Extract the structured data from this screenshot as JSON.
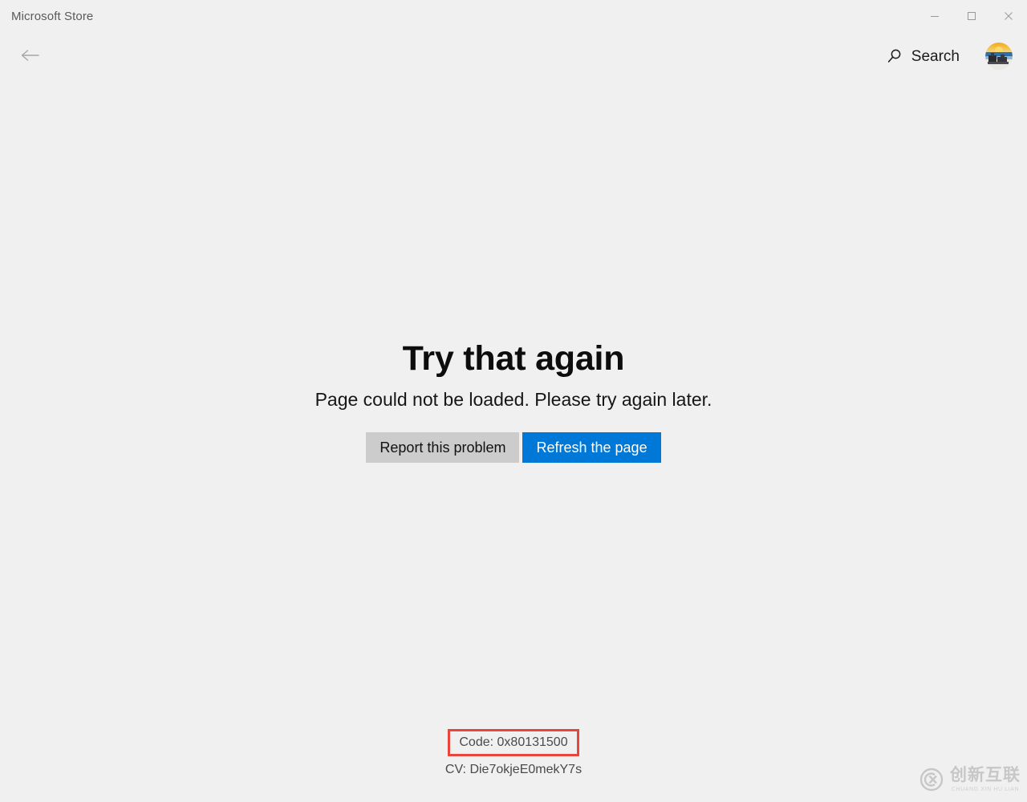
{
  "window": {
    "title": "Microsoft Store",
    "controls": {
      "minimize": "minimize-icon",
      "maximize": "maximize-icon",
      "close": "close-icon"
    }
  },
  "header": {
    "back_icon": "back-arrow-icon",
    "search_icon": "search-icon",
    "search_label": "Search",
    "avatar": "user-avatar"
  },
  "main": {
    "title": "Try that again",
    "subtitle": "Page could not be loaded. Please try again later.",
    "buttons": [
      {
        "label": "Report this problem",
        "style": "secondary"
      },
      {
        "label": "Refresh the page",
        "style": "primary"
      }
    ]
  },
  "footer": {
    "code": "Code: 0x80131500",
    "cv": "CV: Die7okjeE0mekY7s",
    "highlight_color": "#e8453c"
  },
  "watermark": {
    "cn": "创新互联",
    "en": "CHUANG XIN HU LIAN"
  },
  "colors": {
    "background": "#f0f0f0",
    "accent": "#0078d7",
    "secondary_button": "#cccccc",
    "title_text": "#5a5a5a"
  }
}
